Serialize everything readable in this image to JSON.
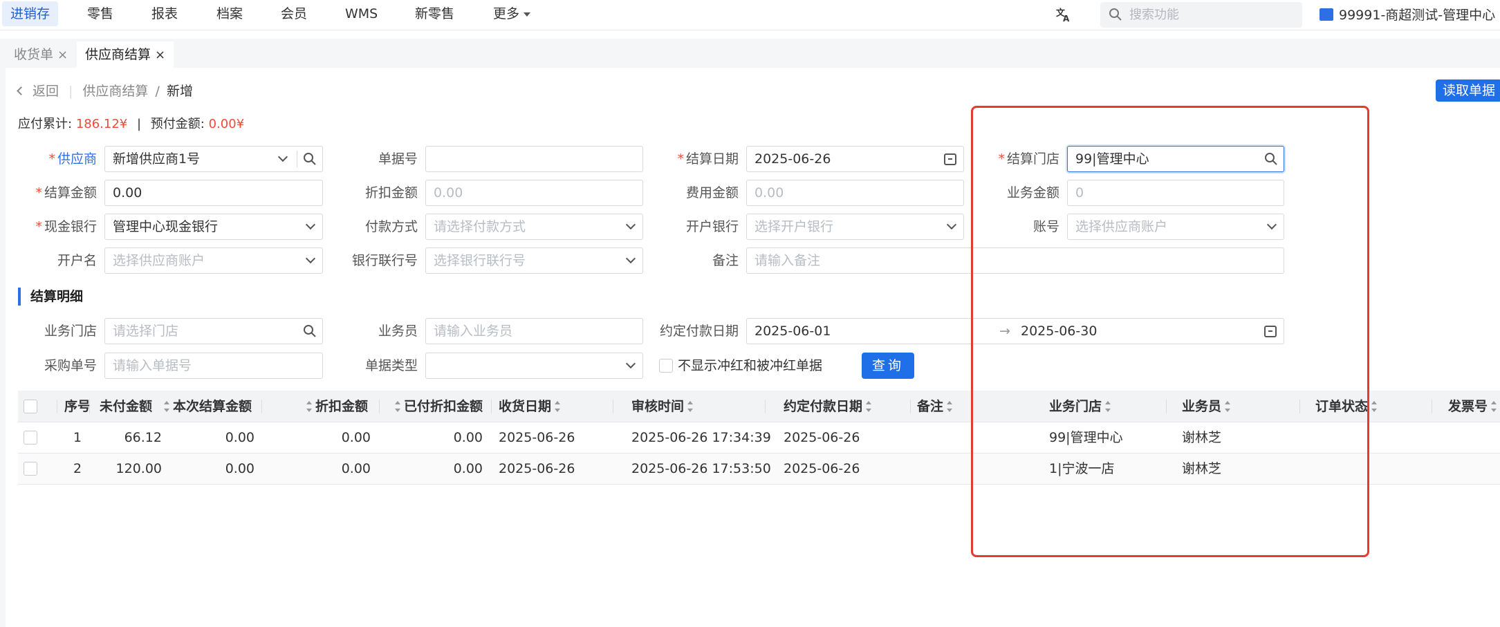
{
  "topnav": {
    "items": [
      "进销存",
      "零售",
      "报表",
      "档案",
      "会员",
      "WMS",
      "新零售",
      "更多"
    ],
    "search_placeholder": "搜索功能",
    "org_label": "99991-商超测试-管理中心"
  },
  "tabs": [
    {
      "label": "收货单",
      "close": "×"
    },
    {
      "label": "供应商结算",
      "close": "×"
    }
  ],
  "breadcrumb": {
    "back": "返回",
    "parent": "供应商结算",
    "slash": "/",
    "current": "新增"
  },
  "read_button": "读取单据",
  "summary": {
    "payable_label": "应付累计:",
    "payable_value": "186.12¥",
    "divider": "|",
    "prepaid_label": "预付金额:",
    "prepaid_value": "0.00¥"
  },
  "form": {
    "req_mark": "*",
    "supplier_label": "供应商",
    "supplier_value": "新增供应商1号",
    "doc_no_label": "单据号",
    "doc_no_value": "",
    "settle_date_label": "结算日期",
    "settle_date_value": "2025-06-26",
    "settle_store_label": "结算门店",
    "settle_store_value": "99|管理中心",
    "settle_amount_label": "结算金额",
    "settle_amount_value": "0.00",
    "discount_label": "折扣金额",
    "discount_placeholder": "0.00",
    "fee_label": "费用金额",
    "fee_placeholder": "0.00",
    "business_amount_label": "业务金额",
    "business_amount_placeholder": "0",
    "cash_bank_label": "现金银行",
    "cash_bank_value": "管理中心现金银行",
    "pay_method_label": "付款方式",
    "pay_method_placeholder": "请选择付款方式",
    "open_bank_label": "开户银行",
    "open_bank_placeholder": "选择开户银行",
    "account_label": "账号",
    "account_placeholder": "选择供应商账户",
    "account_name_label": "开户名",
    "account_name_placeholder": "选择供应商账户",
    "bank_code_label": "银行联行号",
    "bank_code_placeholder": "选择银行联行号",
    "remark_label": "备注",
    "remark_placeholder": "请输入备注"
  },
  "detail": {
    "title": "结算明细",
    "store_label": "业务门店",
    "store_placeholder": "请选择门店",
    "clerk_label": "业务员",
    "clerk_placeholder": "请输入业务员",
    "due_date_label": "约定付款日期",
    "due_from": "2025-06-01",
    "arrow": "→",
    "due_to": "2025-06-30",
    "purchase_no_label": "采购单号",
    "purchase_no_placeholder": "请输入单据号",
    "doc_type_label": "单据类型",
    "doc_type_value": "",
    "hide_red_label": "不显示冲红和被冲红单据",
    "query_button": "查询"
  },
  "table": {
    "headers": [
      "序号",
      "未付金额",
      "本次结算金额",
      "折扣金额",
      "已付折扣金额",
      "收货日期",
      "审核时间",
      "约定付款日期",
      "备注",
      "业务门店",
      "业务员",
      "订单状态",
      "发票号"
    ],
    "rows": [
      {
        "no": "1",
        "unpaid": "66.12",
        "settle": "0.00",
        "discount": "0.00",
        "paid_discount": "0.00",
        "recv_date": "2025-06-26",
        "audit_time": "2025-06-26 17:34:39",
        "due_date": "2025-06-26",
        "remark": "",
        "store": "99|管理中心",
        "clerk": "谢林芝",
        "status": "",
        "invoice": ""
      },
      {
        "no": "2",
        "unpaid": "120.00",
        "settle": "0.00",
        "discount": "0.00",
        "paid_discount": "0.00",
        "recv_date": "2025-06-26",
        "audit_time": "2025-06-26 17:53:50",
        "due_date": "2025-06-26",
        "remark": "",
        "store": "1|宁波一店",
        "clerk": "谢林芝",
        "status": "",
        "invoice": ""
      }
    ]
  },
  "colors": {
    "primary": "#1f6fe8",
    "danger": "#f04a3a",
    "highlight_box": "#e53a2d"
  }
}
